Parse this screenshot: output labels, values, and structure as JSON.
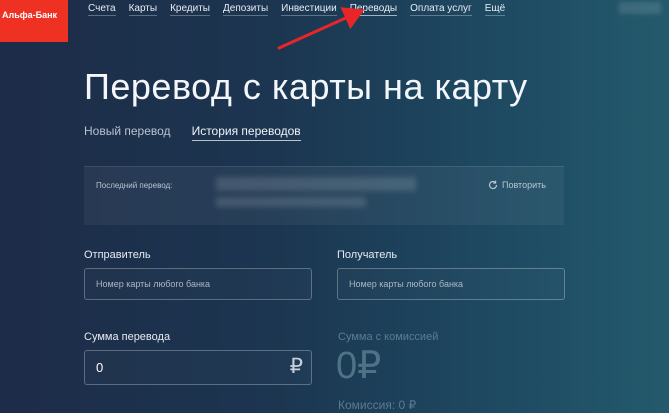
{
  "logo": {
    "text": "Альфа-Банк",
    "color": "#ef3124"
  },
  "nav": {
    "items": [
      {
        "label": "Счета"
      },
      {
        "label": "Карты"
      },
      {
        "label": "Кредиты"
      },
      {
        "label": "Депозиты"
      },
      {
        "label": "Инвестиции"
      },
      {
        "label": "Переводы"
      },
      {
        "label": "Оплата услуг"
      },
      {
        "label": "Ещё"
      }
    ]
  },
  "page": {
    "title": "Перевод с карты на карту",
    "tabs": [
      {
        "label": "Новый перевод",
        "active": false
      },
      {
        "label": "История переводов",
        "active": true
      }
    ]
  },
  "last_transfer": {
    "label": "Последний перевод:",
    "repeat_label": "Повторить",
    "repeat_icon": "refresh-icon"
  },
  "form": {
    "sender": {
      "label": "Отправитель",
      "placeholder": "Номер карты любого банка"
    },
    "recipient": {
      "label": "Получатель",
      "placeholder": "Номер карты любого банка"
    },
    "amount": {
      "label": "Сумма перевода",
      "value": "0",
      "currency": "₽"
    },
    "total": {
      "label": "Сумма с комиссией",
      "value": "0₽"
    },
    "fee": {
      "label": "Комиссия: 0 ₽"
    }
  },
  "annotation": {
    "arrow_color": "#e8262a",
    "points_to": "Переводы"
  }
}
